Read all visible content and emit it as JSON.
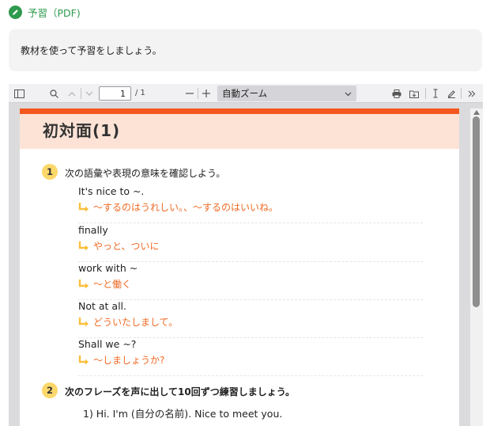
{
  "header": {
    "title": "予習（PDF)"
  },
  "note": {
    "text": "教材を使って予習をしましょう。"
  },
  "toolbar": {
    "page_current": "1",
    "page_total": "/ 1",
    "zoom_label": "自動ズーム",
    "icons": [
      "sidebar-toggle-icon",
      "search-icon",
      "previous-page-icon",
      "next-page-icon",
      "zoom-out-icon",
      "zoom-in-icon",
      "print-icon",
      "download-icon",
      "text-cursor-icon",
      "pen-icon",
      "more-tools-icon"
    ]
  },
  "pdf": {
    "title": "初対面(1)",
    "q1": {
      "num": "1",
      "text": "次の語彙や表現の意味を確認しよう。"
    },
    "items": [
      {
        "en": "It's nice to ~.",
        "jp": "～するのはうれしい。、～するのはいいね。"
      },
      {
        "en": "finally",
        "jp": "やっと、ついに"
      },
      {
        "en": "work with ~",
        "jp": "～と働く"
      },
      {
        "en": "Not at all.",
        "jp": "どういたしまして。"
      },
      {
        "en": "Shall we ~?",
        "jp": "～しましょうか?"
      }
    ],
    "q2": {
      "num": "2",
      "text": "次のフレーズを声に出して10回ずつ練習しましょう。"
    },
    "line1": "1)  Hi. I'm (自分の名前). Nice to meet you."
  },
  "colors": {
    "brand_green": "#2e9a4d",
    "accent_orange": "#f4581f",
    "band_peach": "#fde3d6",
    "number_yellow": "#fcd86b",
    "answer_orange": "#f06a24"
  }
}
